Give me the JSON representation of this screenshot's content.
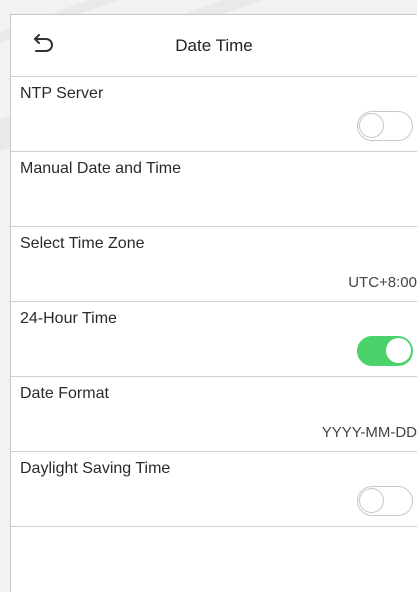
{
  "header": {
    "title": "Date Time",
    "back_icon": "back-arrow-icon"
  },
  "settings": {
    "ntp_server": {
      "label": "NTP Server",
      "toggle_on": false
    },
    "manual_date_time": {
      "label": "Manual Date and Time"
    },
    "time_zone": {
      "label": "Select Time Zone",
      "value": "UTC+8:00"
    },
    "hour_24": {
      "label": "24-Hour Time",
      "toggle_on": true
    },
    "date_format": {
      "label": "Date Format",
      "value": "YYYY-MM-DD"
    },
    "daylight_saving": {
      "label": "Daylight Saving Time",
      "toggle_on": false
    }
  },
  "colors": {
    "toggle_on": "#4cd26b",
    "toggle_off_border": "#c8c8c8",
    "divider": "#cfcfcf"
  }
}
